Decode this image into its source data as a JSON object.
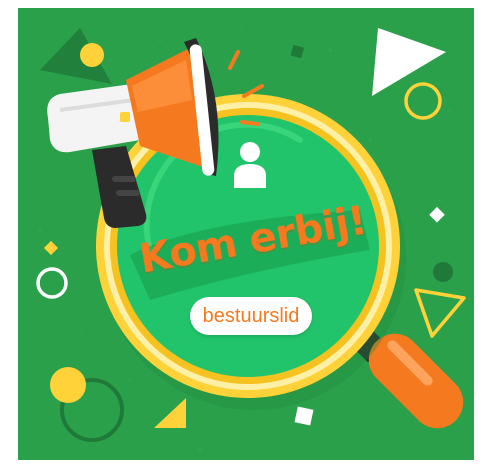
{
  "poster": {
    "headline": "Kom erbij!",
    "role_label": "bestuurslid"
  },
  "colors": {
    "background_green": "#2aa04a",
    "accent_orange": "#f57a1f",
    "ring_yellow": "#ffd23a",
    "lens_green": "#21c46a",
    "white": "#ffffff"
  },
  "icons": {
    "megaphone": "megaphone-icon",
    "magnifier": "magnifying-glass-icon",
    "person": "person-icon"
  }
}
